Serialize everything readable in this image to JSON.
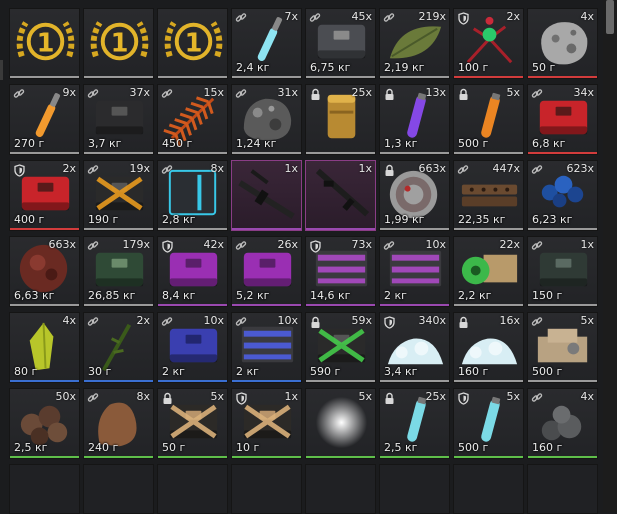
{
  "colors": {
    "gray": "#9a9a9a",
    "green": "#5fbf4a",
    "red": "#d23c3c",
    "blue": "#3a6fd1",
    "purple": "#9a49b0",
    "gold": "#c9a227"
  },
  "items": [
    {
      "name": "medal-1",
      "qty": "",
      "weight": "",
      "icon": "medal",
      "bar": "gray",
      "badge": ""
    },
    {
      "name": "medal-2",
      "qty": "",
      "weight": "",
      "icon": "medal",
      "bar": "gray",
      "badge": ""
    },
    {
      "name": "medal-3",
      "qty": "",
      "weight": "",
      "icon": "medal",
      "bar": "gray",
      "badge": ""
    },
    {
      "name": "cyan-injector",
      "qty": "7x",
      "weight": "2,4 кг",
      "icon": "injector-cyan",
      "bar": "gray",
      "badge": "link"
    },
    {
      "name": "gray-case",
      "qty": "45x",
      "weight": "6,75 кг",
      "icon": "case-gray",
      "bar": "gray",
      "badge": "link"
    },
    {
      "name": "green-leaf",
      "qty": "219x",
      "weight": "2,19 кг",
      "icon": "leaf",
      "bar": "gray",
      "badge": "link"
    },
    {
      "name": "red-flower",
      "qty": "2x",
      "weight": "100 г",
      "icon": "flower",
      "bar": "red",
      "badge": "shield"
    },
    {
      "name": "silver-ore",
      "qty": "4x",
      "weight": "50 г",
      "icon": "ore-silver",
      "bar": "red",
      "badge": ""
    },
    {
      "name": "orange-injector",
      "qty": "9x",
      "weight": "270 г",
      "icon": "injector-orange",
      "bar": "gray",
      "badge": "link"
    },
    {
      "name": "black-case",
      "qty": "37x",
      "weight": "3,7 кг",
      "icon": "case-black",
      "bar": "gray",
      "badge": "link"
    },
    {
      "name": "orange-fern",
      "qty": "15x",
      "weight": "450 г",
      "icon": "fern",
      "bar": "gray",
      "badge": "link"
    },
    {
      "name": "rock-cluster",
      "qty": "31x",
      "weight": "1,24 кг",
      "icon": "rock",
      "bar": "gray",
      "badge": "link"
    },
    {
      "name": "gold-canister",
      "qty": "25x",
      "weight": "",
      "icon": "canister",
      "bar": "gray",
      "badge": "lock"
    },
    {
      "name": "purple-tube",
      "qty": "13x",
      "weight": "1,3 кг",
      "icon": "tube-purple",
      "bar": "gray",
      "badge": "lock"
    },
    {
      "name": "orange-tube",
      "qty": "5x",
      "weight": "500 г",
      "icon": "tube-orange",
      "bar": "gray",
      "badge": "lock"
    },
    {
      "name": "red-case",
      "qty": "34x",
      "weight": "6,8 кг",
      "icon": "case-red",
      "bar": "red",
      "badge": "link"
    },
    {
      "name": "red-case-2",
      "qty": "2x",
      "weight": "400 г",
      "icon": "case-red",
      "bar": "red",
      "badge": "shield"
    },
    {
      "name": "orange-x-case",
      "qty": "19x",
      "weight": "190 г",
      "icon": "case-orangex",
      "bar": "gray",
      "badge": "link"
    },
    {
      "name": "cyan-box",
      "qty": "8x",
      "weight": "2,8 кг",
      "icon": "box-cyan",
      "bar": "gray",
      "badge": "link"
    },
    {
      "name": "rifle",
      "qty": "1x",
      "weight": "",
      "icon": "rifle",
      "bar": "purple",
      "badge": "",
      "purple": true
    },
    {
      "name": "sniper-rifle",
      "qty": "1x",
      "weight": "",
      "icon": "rifle2",
      "bar": "purple",
      "badge": "",
      "purple": true
    },
    {
      "name": "stone-disc",
      "qty": "663x",
      "weight": "1,99 кг",
      "icon": "disc",
      "bar": "gray",
      "badge": "lock"
    },
    {
      "name": "brick-stack",
      "qty": "447x",
      "weight": "22,35 кг",
      "icon": "bricks",
      "bar": "gray",
      "badge": "link"
    },
    {
      "name": "blue-crystals",
      "qty": "623x",
      "weight": "6,23 кг",
      "icon": "crystals",
      "bar": "gray",
      "badge": "link"
    },
    {
      "name": "red-orb",
      "qty": "663x",
      "weight": "6,63 кг",
      "icon": "orb-red",
      "bar": "gray",
      "badge": ""
    },
    {
      "name": "green-case",
      "qty": "179x",
      "weight": "26,85 кг",
      "icon": "case-green",
      "bar": "gray",
      "badge": "link"
    },
    {
      "name": "purple-case",
      "qty": "42x",
      "weight": "8,4 кг",
      "icon": "case-purple",
      "bar": "purple",
      "badge": "shield"
    },
    {
      "name": "purple-case-2",
      "qty": "26x",
      "weight": "5,2 кг",
      "icon": "case-purple",
      "bar": "purple",
      "badge": "link"
    },
    {
      "name": "purple-crate",
      "qty": "73x",
      "weight": "14,6 кг",
      "icon": "crate-purple",
      "bar": "purple",
      "badge": "shield"
    },
    {
      "name": "purple-crate-2",
      "qty": "10x",
      "weight": "2 кг",
      "icon": "crate-purple",
      "bar": "purple",
      "badge": "link"
    },
    {
      "name": "green-spool",
      "qty": "22x",
      "weight": "2,2 кг",
      "icon": "spool",
      "bar": "gray",
      "badge": ""
    },
    {
      "name": "dark-case",
      "qty": "1x",
      "weight": "150 г",
      "icon": "case-dark",
      "bar": "gray",
      "badge": "link"
    },
    {
      "name": "yellow-crystal",
      "qty": "4x",
      "weight": "80 г",
      "icon": "crystal-yellow",
      "bar": "blue",
      "badge": ""
    },
    {
      "name": "green-sprig",
      "qty": "2x",
      "weight": "30 г",
      "icon": "sprig",
      "bar": "blue",
      "badge": "link"
    },
    {
      "name": "blue-case",
      "qty": "10x",
      "weight": "2 кг",
      "icon": "case-blue",
      "bar": "blue",
      "badge": "link"
    },
    {
      "name": "blue-crate",
      "qty": "10x",
      "weight": "2 кг",
      "icon": "crate-blue",
      "bar": "blue",
      "badge": "link"
    },
    {
      "name": "green-x-case",
      "qty": "59x",
      "weight": "590 г",
      "icon": "case-greenx",
      "bar": "gray",
      "badge": "lock"
    },
    {
      "name": "salt-pile",
      "qty": "340x",
      "weight": "3,4 кг",
      "icon": "powder",
      "bar": "gray",
      "badge": "shield"
    },
    {
      "name": "salt-pile-2",
      "qty": "16x",
      "weight": "160 г",
      "icon": "powder",
      "bar": "gray",
      "badge": "lock"
    },
    {
      "name": "box-pile",
      "qty": "5x",
      "weight": "500 г",
      "icon": "box-pile",
      "bar": "gray",
      "badge": "link"
    },
    {
      "name": "brown-rocks",
      "qty": "50x",
      "weight": "2,5 кг",
      "icon": "rocks-brown",
      "bar": "green",
      "badge": ""
    },
    {
      "name": "brown-chunk",
      "qty": "8x",
      "weight": "240 г",
      "icon": "chunk",
      "bar": "green",
      "badge": "link"
    },
    {
      "name": "tan-case",
      "qty": "5x",
      "weight": "50 г",
      "icon": "case-tan",
      "bar": "green",
      "badge": "lock"
    },
    {
      "name": "tan-case-2",
      "qty": "1x",
      "weight": "10 г",
      "icon": "case-tan",
      "bar": "green",
      "badge": "shield"
    },
    {
      "name": "white-cloud",
      "qty": "5x",
      "weight": "",
      "icon": "cloud",
      "bar": "green",
      "badge": ""
    },
    {
      "name": "cyan-tube",
      "qty": "25x",
      "weight": "2,5 кг",
      "icon": "tube-cyan",
      "bar": "green",
      "badge": "lock"
    },
    {
      "name": "cyan-tube-2",
      "qty": "5x",
      "weight": "500 г",
      "icon": "tube-cyan",
      "bar": "green",
      "badge": "shield"
    },
    {
      "name": "gray-spheres",
      "qty": "4x",
      "weight": "160 г",
      "icon": "spheres",
      "bar": "green",
      "badge": "link"
    },
    {
      "name": "empty-1",
      "qty": "",
      "weight": "",
      "icon": "",
      "bar": "",
      "badge": "",
      "empty": true
    },
    {
      "name": "empty-2",
      "qty": "",
      "weight": "",
      "icon": "",
      "bar": "",
      "badge": "",
      "empty": true
    },
    {
      "name": "empty-3",
      "qty": "",
      "weight": "",
      "icon": "",
      "bar": "",
      "badge": "",
      "empty": true
    },
    {
      "name": "empty-4",
      "qty": "",
      "weight": "",
      "icon": "",
      "bar": "",
      "badge": "",
      "empty": true
    },
    {
      "name": "empty-5",
      "qty": "",
      "weight": "",
      "icon": "",
      "bar": "",
      "badge": "",
      "empty": true
    },
    {
      "name": "empty-6",
      "qty": "",
      "weight": "",
      "icon": "",
      "bar": "",
      "badge": "",
      "empty": true
    },
    {
      "name": "empty-7",
      "qty": "",
      "weight": "",
      "icon": "",
      "bar": "",
      "badge": "",
      "empty": true
    },
    {
      "name": "empty-8",
      "qty": "",
      "weight": "",
      "icon": "",
      "bar": "",
      "badge": "",
      "empty": true
    }
  ],
  "medal_label": "1"
}
